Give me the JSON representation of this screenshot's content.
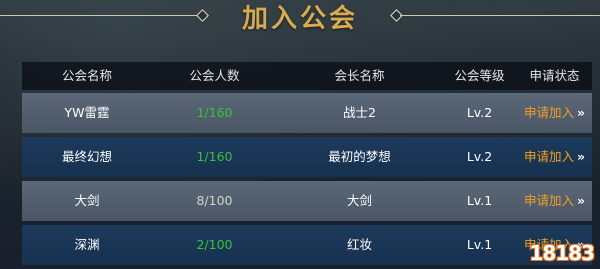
{
  "title": "加入公会",
  "table": {
    "headers": [
      "公会名称",
      "公会人数",
      "会长名称",
      "公会等级",
      "申请状态"
    ],
    "rows": [
      {
        "guild_name": "YW雷霆",
        "members": "1/160",
        "leader": "战士2",
        "level": "Lv.2",
        "apply": "申请加入",
        "style": "light",
        "members_color": "green"
      },
      {
        "guild_name": "最终幻想",
        "members": "1/160",
        "leader": "最初的梦想",
        "level": "Lv.2",
        "apply": "申请加入",
        "style": "dark",
        "members_color": "green"
      },
      {
        "guild_name": "大剑",
        "members": "8/100",
        "leader": "大剑",
        "level": "Lv.1",
        "apply": "申请加入",
        "style": "light",
        "members_color": "dim"
      },
      {
        "guild_name": "深渊",
        "members": "2/100",
        "leader": "红妆",
        "level": "Lv.1",
        "apply": "申请加入",
        "style": "dark",
        "members_color": "green"
      }
    ]
  },
  "arrow_glyph": "»",
  "watermark": "18183",
  "colors": {
    "title": "#d9ab4f",
    "apply": "#f0a020",
    "members_green": "#39c23a"
  }
}
